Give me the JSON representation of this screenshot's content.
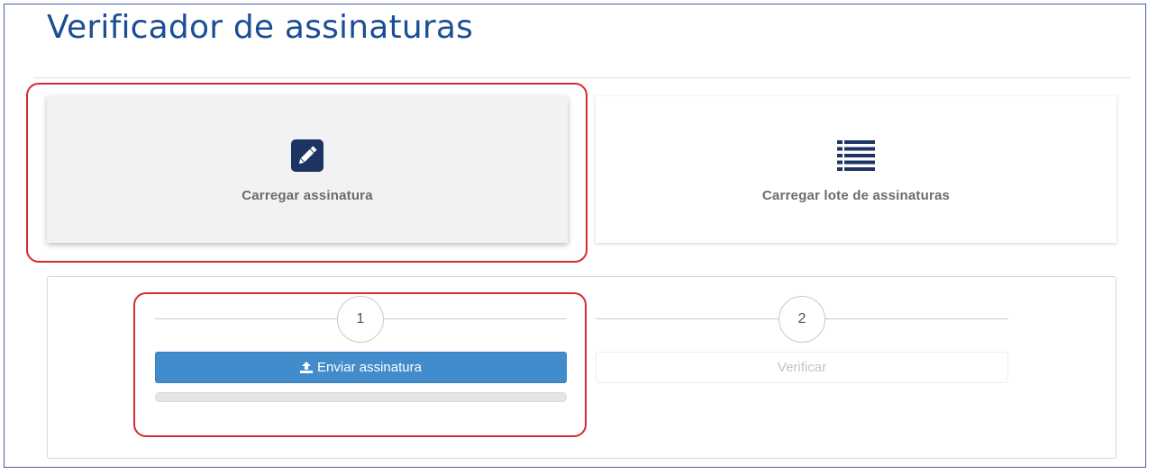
{
  "page": {
    "title": "Verificador de assinaturas"
  },
  "cards": [
    {
      "label": "Carregar assinatura",
      "icon": "pencil-square-icon",
      "selected": true
    },
    {
      "label": "Carregar lote de assinaturas",
      "icon": "list-icon",
      "selected": false
    }
  ],
  "wizard": {
    "steps": [
      {
        "number": "1",
        "button_label": "Enviar assinatura",
        "button_icon": "upload-icon",
        "enabled": true
      },
      {
        "number": "2",
        "button_label": "Verificar",
        "enabled": false
      }
    ],
    "upload_progress": 0
  },
  "colors": {
    "title": "#1a4f95",
    "icon": "#1b3461",
    "primary_button": "#438ccb",
    "highlight": "#d42b2f"
  }
}
